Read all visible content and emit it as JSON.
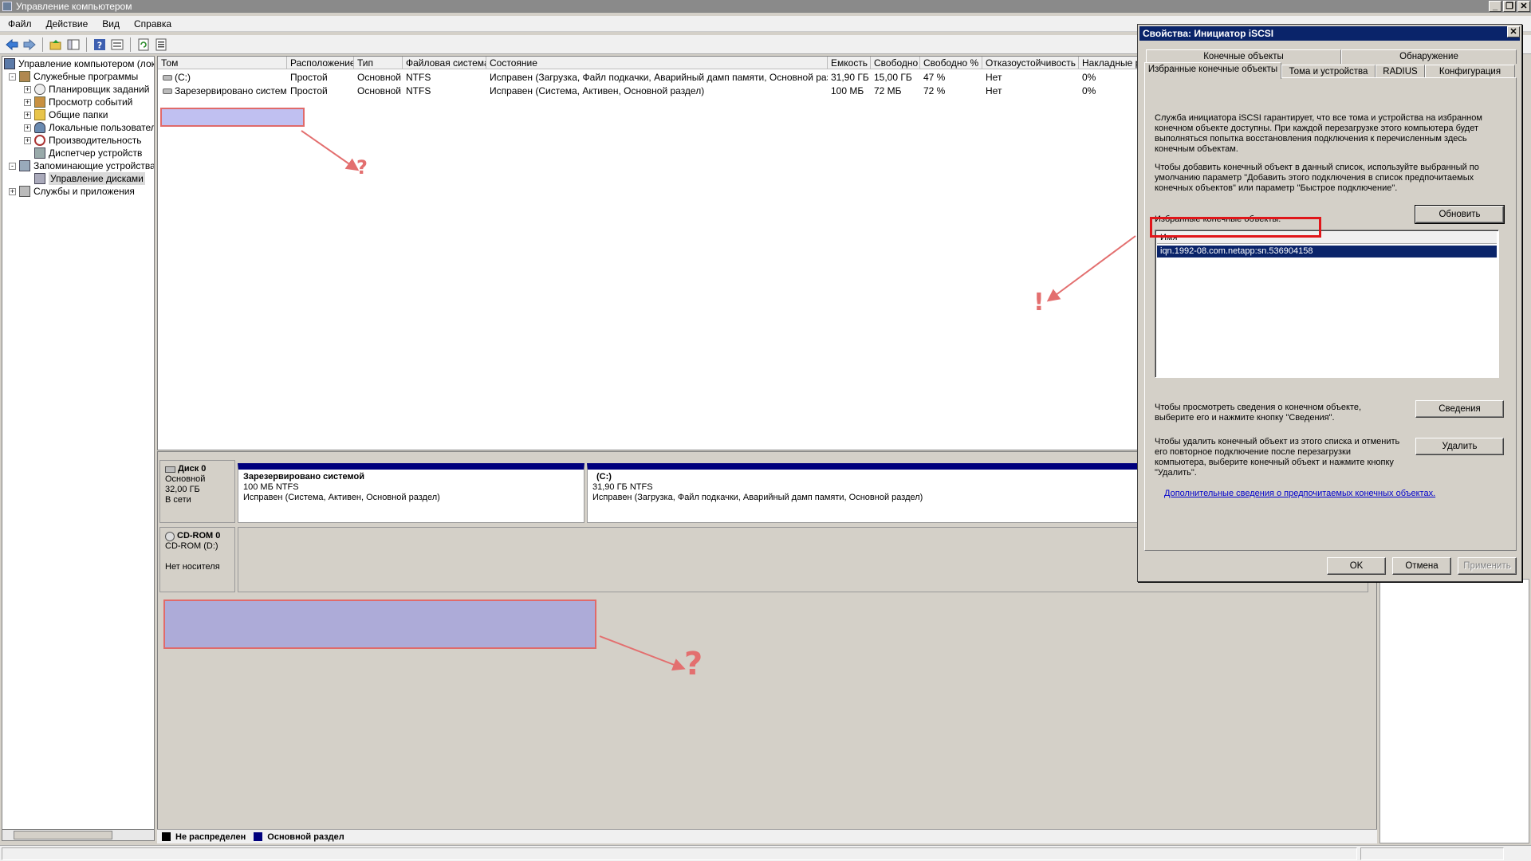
{
  "window": {
    "title": "Управление компьютером",
    "buttons": [
      "_",
      "❐",
      "✕"
    ]
  },
  "menu": [
    "Файл",
    "Действие",
    "Вид",
    "Справка"
  ],
  "toolbar": [
    "back-icon",
    "forward-icon",
    "up-folder-icon",
    "console-tree-icon",
    "help-icon",
    "properties-icon",
    "refresh-icon",
    "export-icon"
  ],
  "tree": {
    "items": [
      {
        "label": "Управление компьютером (лока",
        "icon": "computer-icon",
        "expander": "-"
      },
      {
        "label": "Служебные программы",
        "icon": "tools-icon",
        "expander": "-"
      },
      {
        "label": "Планировщик заданий",
        "icon": "clock-icon",
        "expander": "+"
      },
      {
        "label": "Просмотр событий",
        "icon": "event-viewer-icon",
        "expander": "+"
      },
      {
        "label": "Общие папки",
        "icon": "shared-folders-icon",
        "expander": "+"
      },
      {
        "label": "Локальные пользовател",
        "icon": "users-icon",
        "expander": "+"
      },
      {
        "label": "Производительность",
        "icon": "performance-icon",
        "expander": "+"
      },
      {
        "label": "Диспетчер устройств",
        "icon": "device-manager-icon",
        "expander": ""
      },
      {
        "label": "Запоминающие устройства",
        "icon": "storage-icon",
        "expander": "-"
      },
      {
        "label": "Управление дисками",
        "icon": "disk-management-icon",
        "expander": ""
      },
      {
        "label": "Службы и приложения",
        "icon": "services-icon",
        "expander": "+"
      }
    ]
  },
  "volumes": {
    "columns": [
      "Том",
      "Расположение",
      "Тип",
      "Файловая система",
      "Состояние",
      "Емкость",
      "Свободно",
      "Свободно %",
      "Отказоустойчивость",
      "Накладные р"
    ],
    "rows": [
      [
        "(C:)",
        "Простой",
        "Основной",
        "NTFS",
        "Исправен (Загрузка, Файл подкачки, Аварийный дамп памяти, Основной раздел)",
        "31,90 ГБ",
        "15,00 ГБ",
        "47 %",
        "Нет",
        "0%"
      ],
      [
        "Зарезервировано системой",
        "Простой",
        "Основной",
        "NTFS",
        "Исправен (Система, Активен, Основной раздел)",
        "100 МБ",
        "72 МБ",
        "72 %",
        "Нет",
        "0%"
      ]
    ]
  },
  "disks": [
    {
      "name": "Диск 0",
      "type": "Основной",
      "size": "32,00 ГБ",
      "state": "В сети"
    },
    {
      "name": "CD-ROM 0",
      "type": "CD-ROM (D:)",
      "size": "",
      "state": "Нет носителя"
    }
  ],
  "partitions": [
    {
      "title": "Зарезервировано системой",
      "size": "100 МБ NTFS",
      "status": "Исправен (Система, Активен, Основной раздел)"
    },
    {
      "title": "(C:)",
      "size": "31,90 ГБ NTFS",
      "status": "Исправен (Загрузка, Файл подкачки, Аварийный дамп памяти, Основной раздел)"
    }
  ],
  "legend": [
    {
      "label": "Не распределен",
      "color": "#000000"
    },
    {
      "label": "Основной раздел",
      "color": "#00007d"
    }
  ],
  "dialog": {
    "title": "Свойства: Инициатор iSCSI",
    "close": "✕",
    "tabs_row1": [
      "Конечные объекты",
      "Обнаружение"
    ],
    "tabs_row2": [
      "Избранные конечные объекты",
      "Тома и устройства",
      "RADIUS",
      "Конфигурация"
    ],
    "intro_text": "Служба инициатора iSCSI гарантирует, что все тома и устройства на избранном конечном объекте доступны. При каждой перезагрузке этого компьютера будет выполняться попытка восстановления подключения к перечисленным здесь конечным объектам.",
    "add_text": "Чтобы добавить конечный объект в данный список, используйте выбранный по умолчанию параметр \"Добавить этого подключения в список предпочитаемых конечных объектов\" или параметр \"Быстрое подключение\".",
    "list_label": "Избранные конечные объекты:",
    "refresh_button": "Обновить",
    "list_header": "Имя",
    "list_items": [
      "iqn.1992-08.com.netapp:sn.536904158"
    ],
    "details_text": "Чтобы просмотреть сведения о конечном объекте, выберите его и нажмите кнопку \"Сведения\".",
    "details_button": "Сведения",
    "remove_text": "Чтобы удалить конечный объект из этого списка и отменить его повторное подключение после перезагрузки компьютера, выберите конечный объект и нажмите кнопку \"Удалить\".",
    "remove_button": "Удалить",
    "link": "Дополнительные сведения о предпочитаемых конечных объектах.",
    "ok": "OK",
    "cancel": "Отмена",
    "apply": "Применить"
  },
  "annotations": {
    "question_mark": "?",
    "exclamation_mark": "!",
    "color": "#e36f6f"
  }
}
